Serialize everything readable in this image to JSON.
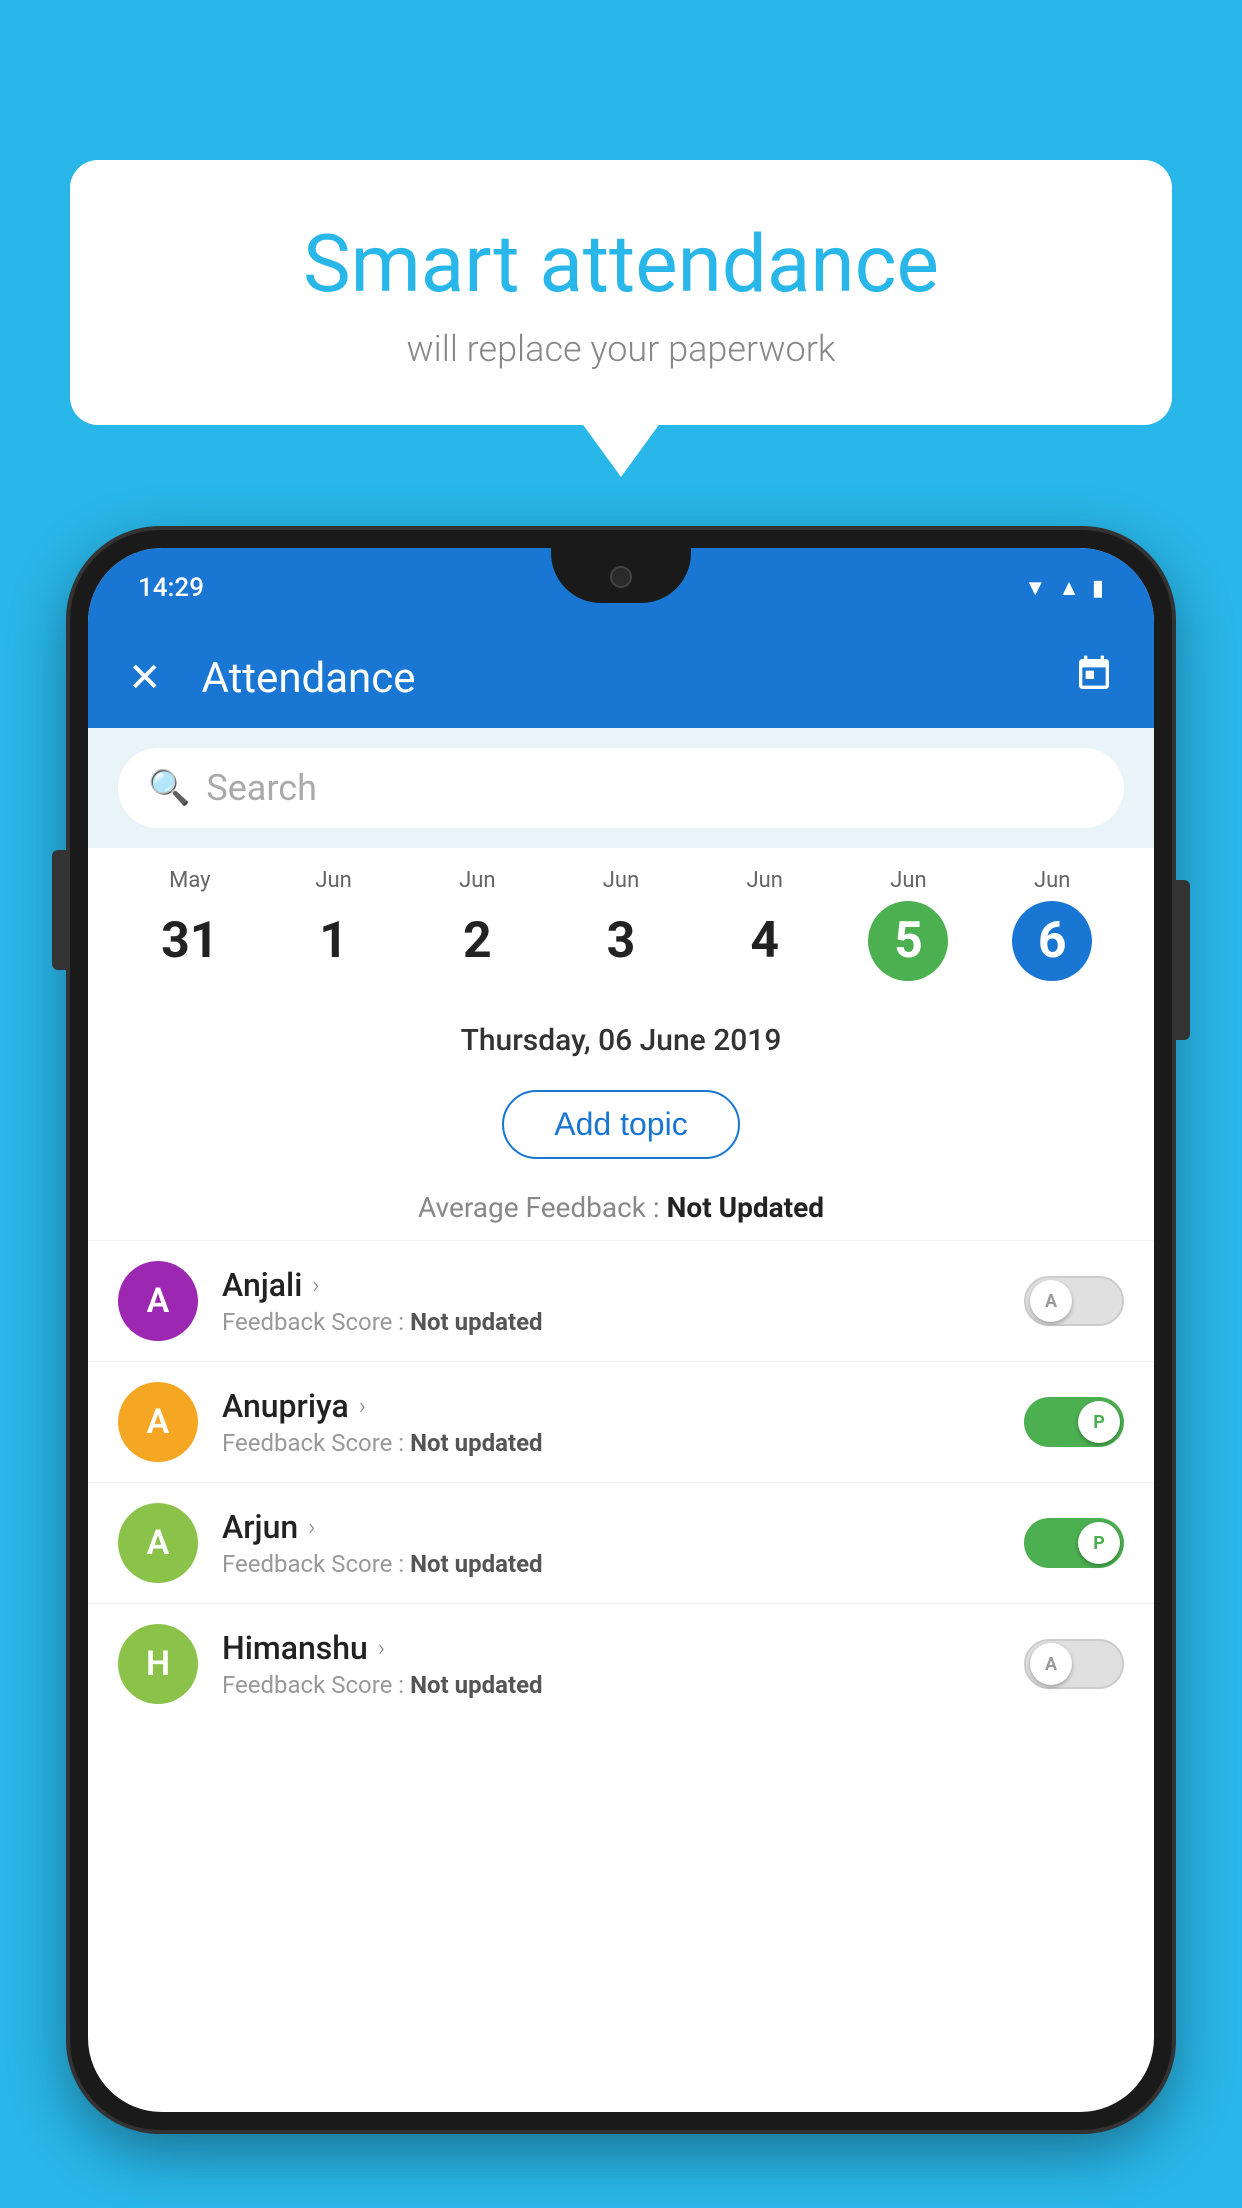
{
  "background_color": "#29b6e8",
  "speech_bubble": {
    "title": "Smart attendance",
    "subtitle": "will replace your paperwork"
  },
  "status_bar": {
    "time": "14:29",
    "icons": [
      "wifi",
      "signal",
      "battery"
    ]
  },
  "app_bar": {
    "title": "Attendance",
    "close_label": "✕",
    "calendar_icon": "📅"
  },
  "search": {
    "placeholder": "Search"
  },
  "calendar": {
    "days": [
      {
        "month": "May",
        "number": "31",
        "state": "normal"
      },
      {
        "month": "Jun",
        "number": "1",
        "state": "normal"
      },
      {
        "month": "Jun",
        "number": "2",
        "state": "normal"
      },
      {
        "month": "Jun",
        "number": "3",
        "state": "normal"
      },
      {
        "month": "Jun",
        "number": "4",
        "state": "normal"
      },
      {
        "month": "Jun",
        "number": "5",
        "state": "today"
      },
      {
        "month": "Jun",
        "number": "6",
        "state": "selected"
      }
    ]
  },
  "selected_date": "Thursday, 06 June 2019",
  "add_topic_label": "Add topic",
  "avg_feedback_label": "Average Feedback :",
  "avg_feedback_value": "Not Updated",
  "students": [
    {
      "name": "Anjali",
      "initial": "A",
      "avatar_color": "#9c27b0",
      "feedback": "Feedback Score :",
      "feedback_value": "Not updated",
      "toggle_state": "off",
      "toggle_label": "A"
    },
    {
      "name": "Anupriya",
      "initial": "A",
      "avatar_color": "#f5a623",
      "feedback": "Feedback Score :",
      "feedback_value": "Not updated",
      "toggle_state": "on",
      "toggle_label": "P"
    },
    {
      "name": "Arjun",
      "initial": "A",
      "avatar_color": "#8bc34a",
      "feedback": "Feedback Score :",
      "feedback_value": "Not updated",
      "toggle_state": "on",
      "toggle_label": "P"
    },
    {
      "name": "Himanshu",
      "initial": "H",
      "avatar_color": "#8bc34a",
      "feedback": "Feedback Score :",
      "feedback_value": "Not updated",
      "toggle_state": "off",
      "toggle_label": "A"
    }
  ]
}
